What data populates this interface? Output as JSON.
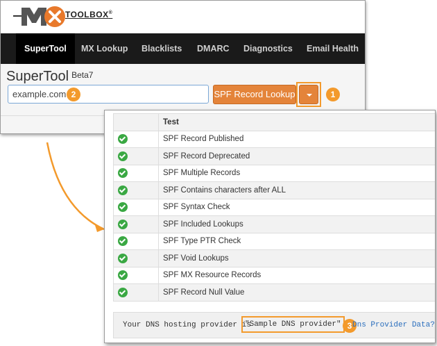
{
  "logo": {
    "text": "TOOLBOX",
    "reg": "®",
    "mark": "MX"
  },
  "nav": {
    "items": [
      {
        "label": "SuperTool",
        "active": true
      },
      {
        "label": "MX Lookup",
        "active": false
      },
      {
        "label": "Blacklists",
        "active": false
      },
      {
        "label": "DMARC",
        "active": false
      },
      {
        "label": "Diagnostics",
        "active": false
      },
      {
        "label": "Email Health",
        "active": false
      }
    ]
  },
  "supertool": {
    "title": "SuperTool",
    "beta": "Beta7",
    "input_value": "example.com",
    "lookup_label": "SPF Record Lookup"
  },
  "callouts": {
    "one": "1",
    "two": "2",
    "three": "3"
  },
  "results": {
    "header_test": "Test",
    "rows": [
      {
        "status": "pass",
        "test": "SPF Record Published"
      },
      {
        "status": "pass",
        "test": "SPF Record Deprecated"
      },
      {
        "status": "pass",
        "test": "SPF Multiple Records"
      },
      {
        "status": "pass",
        "test": "SPF Contains characters after ALL"
      },
      {
        "status": "pass",
        "test": "SPF Syntax Check"
      },
      {
        "status": "pass",
        "test": "SPF Included Lookups"
      },
      {
        "status": "pass",
        "test": "SPF Type PTR Check"
      },
      {
        "status": "pass",
        "test": "SPF Void Lookups"
      },
      {
        "status": "pass",
        "test": "SPF MX Resource Records"
      },
      {
        "status": "pass",
        "test": "SPF Record Null Value"
      }
    ]
  },
  "provider": {
    "prefix": "Your DNS hosting provider is",
    "value": "\"Sample DNS provider\"",
    "link": "Dns Provider Data?"
  },
  "colors": {
    "accent": "#f39a2c",
    "button": "#e4843a",
    "pass": "#3aa843",
    "navbar": "#1a1a1a",
    "link": "#2a6ebd"
  },
  "icons": {
    "status_pass": "check-circle-icon",
    "dropdown": "caret-down-icon",
    "connector": "curved-arrow-icon"
  }
}
